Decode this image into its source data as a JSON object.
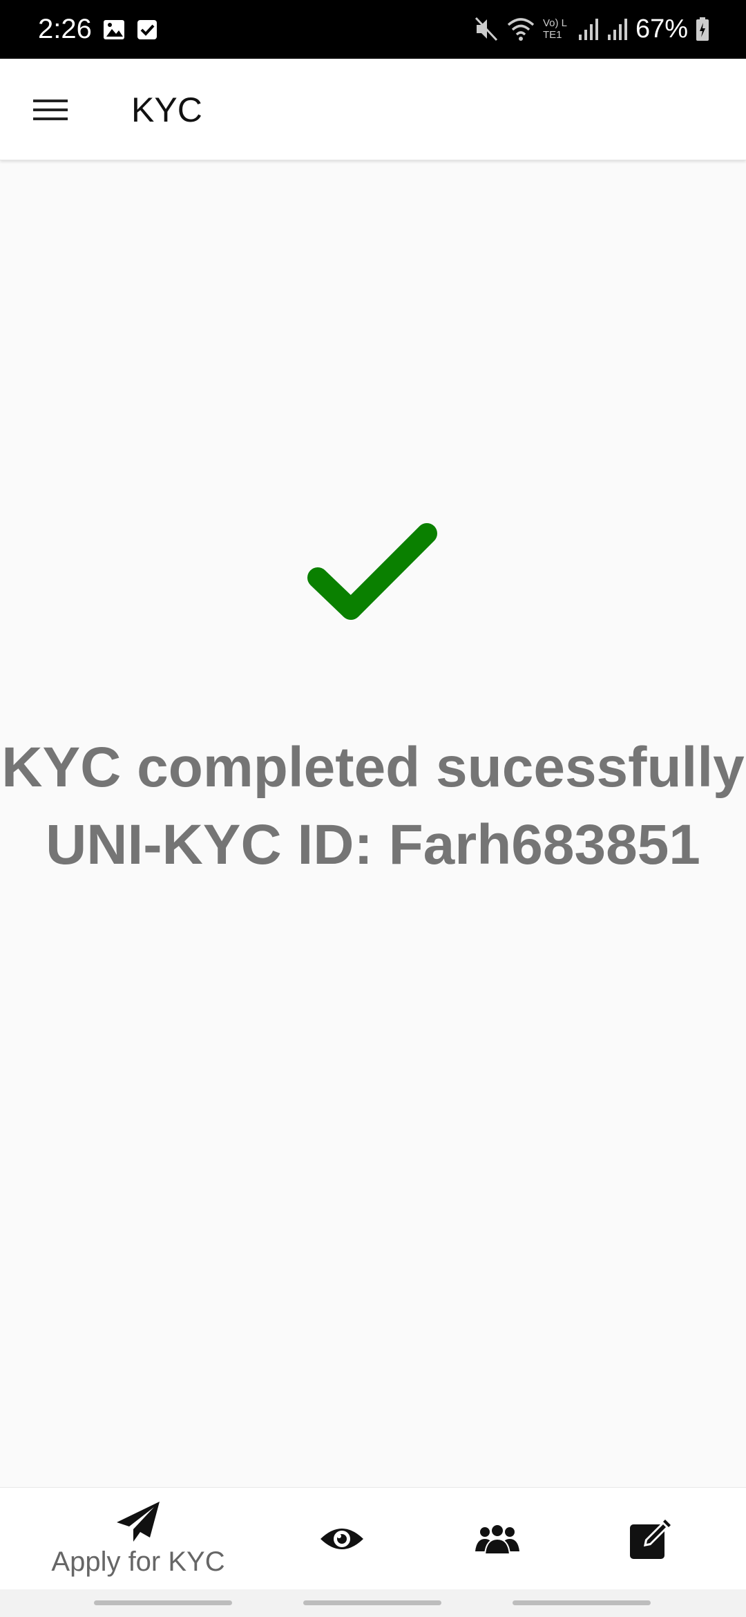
{
  "status_bar": {
    "time": "2:26",
    "battery": "67%",
    "network_label": "Vo) LTE1",
    "icons": [
      "image-icon",
      "checkbox-notification-icon",
      "mute-icon",
      "wifi-icon",
      "signal-icon",
      "battery-icon"
    ]
  },
  "app_bar": {
    "title": "KYC",
    "menu_icon": "hamburger-menu-icon"
  },
  "content": {
    "status_icon": "checkmark-icon",
    "status_color": "#0a8000",
    "message_line1": "KYC completed sucessfully",
    "message_line2": "UNI-KYC ID: Farh683851"
  },
  "bottom_nav": {
    "items": [
      {
        "label": "Apply for KYC",
        "icon": "paper-plane-icon"
      },
      {
        "label": "",
        "icon": "eye-icon"
      },
      {
        "label": "",
        "icon": "people-icon"
      },
      {
        "label": "",
        "icon": "edit-icon"
      }
    ]
  },
  "colors": {
    "status_bar_bg": "#000000",
    "app_bar_bg": "#ffffff",
    "page_bg": "#fafafa",
    "message_text": "#757575",
    "check_green": "#0a8000"
  }
}
